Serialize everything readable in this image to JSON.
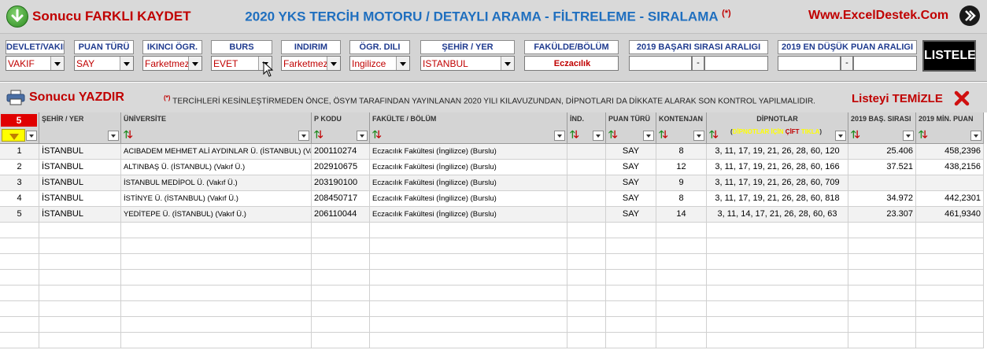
{
  "header": {
    "save_label": "Sonucu FARKLI KAYDET",
    "app_title": "2020 YKS TERCİH MOTORU / DETAYLI ARAMA - FİLTRELEME - SIRALAMA",
    "title_mark": "(*)",
    "website": "Www.ExcelDestek.Com",
    "close_icon": "circle-arrow-icon"
  },
  "filters": {
    "devlet_vakif": {
      "label": "DEVLET/VAKIF",
      "value": "VAKIF"
    },
    "puan_turu": {
      "label": "PUAN TÜRÜ",
      "value": "SAY"
    },
    "ikinci_ogr": {
      "label": "IKINCI ÖGR.",
      "value": "Farketmez"
    },
    "burs": {
      "label": "BURS",
      "value": "EVET"
    },
    "indirim": {
      "label": "INDIRIM",
      "value": "Farketmez"
    },
    "ogr_dili": {
      "label": "ÖGR. DILI",
      "value": "Ingilizce"
    },
    "sehir": {
      "label": "ŞEHİR / YER",
      "value": "ISTANBUL"
    },
    "fakulte": {
      "label": "FAKÜLDE/BÖLÜM",
      "value": "Eczacılık"
    },
    "basari_sirasi": {
      "label": "2019 BAŞARI SIRASI ARALIGI",
      "from": "",
      "dash": "-",
      "to": ""
    },
    "dusuk_puan": {
      "label": "2019 EN DÜŞÜK PUAN ARALIGI",
      "from": "",
      "dash": "-",
      "to": ""
    },
    "listele_label": "LISTELE"
  },
  "printbar": {
    "print_label": "Sonucu YAZDIR",
    "note_mark": "(*)",
    "note": "TERCİHLERİ KESİNLEŞTİRMEDEN ÖNCE, ÖSYM TARAFINDAN YAYINLANAN 2020 YILI KILAVUZUNDAN, DİPNOTLARI DA DİKKATE ALARAK SON KONTROL YAPILMALIDIR.",
    "clear_label": "Listeyi TEMİZLE"
  },
  "table": {
    "result_count": "5",
    "columns": {
      "sehir": "ŞEHİR / YER",
      "universite": "ÜNİVERSİTE",
      "pkodu": "P KODU",
      "fakulte": "FAKÜLTE / BÖLÜM",
      "ind": "İND.",
      "puan": "PUAN TÜRÜ",
      "kontenjan": "KONTENJAN",
      "dipnotlar": "DİPNOTLAR",
      "dip_hint_open": "(",
      "dip_hint_1": "DİPNOTLAR İÇİN",
      "dip_hint_2": "ÇİFT",
      "dip_hint_3": "TIKLA",
      "dip_hint_close": ")",
      "basari": "2019 BAŞ. SIRASI",
      "min_puan": "2019 MİN. PUAN"
    },
    "rows": [
      {
        "no": "1",
        "sehir": "İSTANBUL",
        "universite": "ACIBADEM MEHMET ALİ AYDINLAR Ü. (İSTANBUL) (Vakıf Ü.)",
        "pkodu": "200110274",
        "fakulte": "Eczacılık Fakültesi (İngilizce) (Burslu)",
        "ind": "",
        "puan": "SAY",
        "kontenjan": "8",
        "dipnotlar": "3, 11, 17, 19, 21, 26, 28, 60, 120",
        "basari": "25.406",
        "min_puan": "458,2396"
      },
      {
        "no": "2",
        "sehir": "İSTANBUL",
        "universite": "ALTINBAŞ Ü. (İSTANBUL) (Vakıf Ü.)",
        "pkodu": "202910675",
        "fakulte": "Eczacılık Fakültesi (İngilizce) (Burslu)",
        "ind": "",
        "puan": "SAY",
        "kontenjan": "12",
        "dipnotlar": "3, 11, 17, 19, 21, 26, 28, 60, 166",
        "basari": "37.521",
        "min_puan": "438,2156"
      },
      {
        "no": "3",
        "sehir": "İSTANBUL",
        "universite": "İSTANBUL MEDİPOL Ü.  (Vakıf Ü.)",
        "pkodu": "203190100",
        "fakulte": "Eczacılık Fakültesi (İngilizce) (Burslu)",
        "ind": "",
        "puan": "SAY",
        "kontenjan": "9",
        "dipnotlar": "3, 11, 17, 19, 21, 26, 28, 60, 709",
        "basari": "",
        "min_puan": ""
      },
      {
        "no": "4",
        "sehir": "İSTANBUL",
        "universite": "İSTİNYE Ü. (İSTANBUL) (Vakıf Ü.)",
        "pkodu": "208450717",
        "fakulte": "Eczacılık Fakültesi (İngilizce) (Burslu)",
        "ind": "",
        "puan": "SAY",
        "kontenjan": "8",
        "dipnotlar": "3, 11, 17, 19, 21, 26, 28, 60, 818",
        "basari": "34.972",
        "min_puan": "442,2301"
      },
      {
        "no": "5",
        "sehir": "İSTANBUL",
        "universite": "YEDİTEPE Ü. (İSTANBUL) (Vakıf Ü.)",
        "pkodu": "206110044",
        "fakulte": "Eczacılık Fakültesi (İngilizce) (Burslu)",
        "ind": "",
        "puan": "SAY",
        "kontenjan": "14",
        "dipnotlar": "3, 11, 14, 17, 21, 26, 28, 60, 63",
        "basari": "23.307",
        "min_puan": "461,9340"
      }
    ]
  }
}
